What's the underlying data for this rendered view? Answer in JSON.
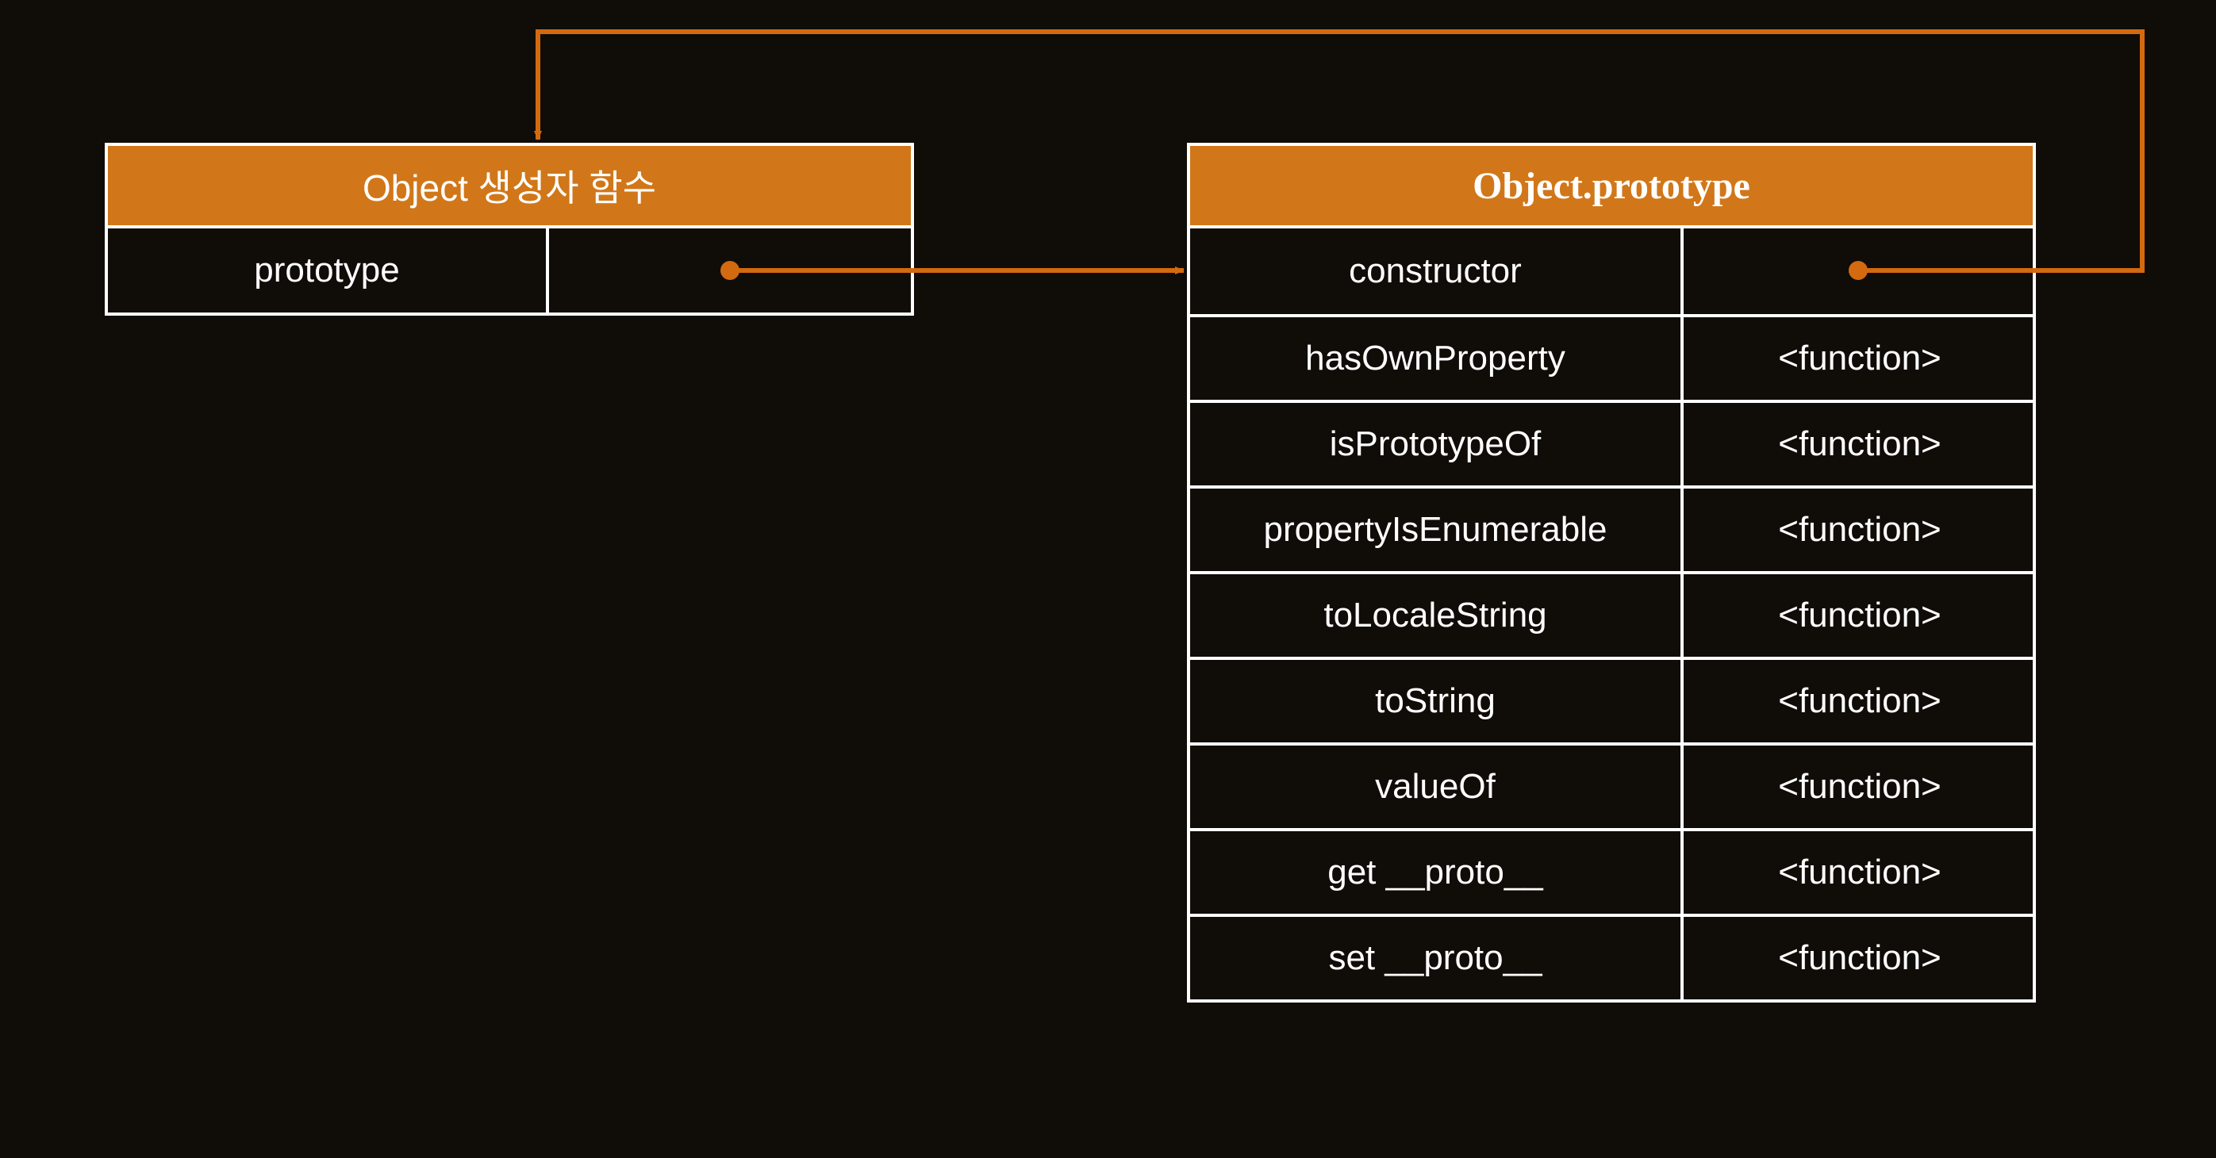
{
  "colors": {
    "background": "#100c08",
    "accent": "#d17719",
    "arrow": "#d36a0f",
    "border": "#ffffff"
  },
  "left": {
    "title": "Object 생성자 함수",
    "row": {
      "key": "prototype",
      "value": ""
    }
  },
  "right": {
    "title": "Object.prototype",
    "rows": [
      {
        "key": "constructor",
        "value": ""
      },
      {
        "key": "hasOwnProperty",
        "value": "<function>"
      },
      {
        "key": "isPrototypeOf",
        "value": "<function>"
      },
      {
        "key": "propertyIsEnumerable",
        "value": "<function>"
      },
      {
        "key": "toLocaleString",
        "value": "<function>"
      },
      {
        "key": "toString",
        "value": "<function>"
      },
      {
        "key": "valueOf",
        "value": "<function>"
      },
      {
        "key": "get __proto__",
        "value": "<function>"
      },
      {
        "key": "set __proto__",
        "value": "<function>"
      }
    ]
  },
  "arrows": [
    {
      "from": "left.prototype",
      "to": "right"
    },
    {
      "from": "right.constructor",
      "to": "left"
    }
  ]
}
